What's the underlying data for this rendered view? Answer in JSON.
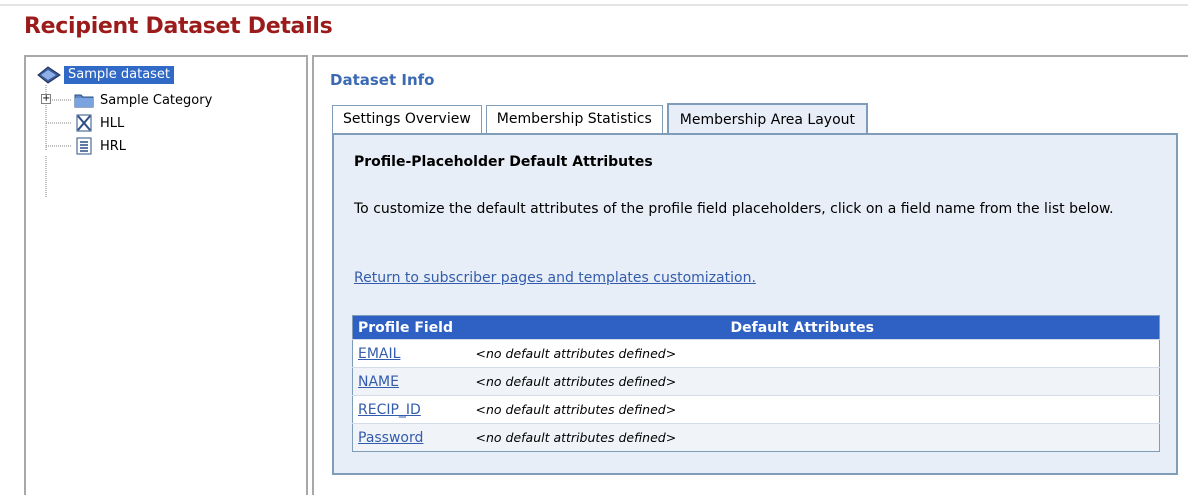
{
  "page": {
    "title": "Recipient Dataset Details"
  },
  "tree": {
    "root": {
      "label": "Sample dataset",
      "icon": "dataset-icon"
    },
    "items": [
      {
        "label": "Sample Category",
        "icon": "folder-icon",
        "expander": "+"
      },
      {
        "label": "HLL",
        "icon": "list-crossed-icon"
      },
      {
        "label": "HRL",
        "icon": "list-document-icon"
      }
    ]
  },
  "main": {
    "section_title": "Dataset Info",
    "tabs": [
      {
        "label": "Settings Overview",
        "active": false
      },
      {
        "label": "Membership Statistics",
        "active": false
      },
      {
        "label": "Membership Area Layout",
        "active": true
      }
    ],
    "heading": "Profile-Placeholder Default Attributes",
    "description": "To customize the default attributes of the profile field placeholders, click on a field name from the list below.",
    "return_link": "Return to subscriber pages and templates customization.",
    "table": {
      "columns": [
        "Profile Field",
        "Default Attributes"
      ],
      "rows": [
        {
          "field": "EMAIL",
          "attributes": "<no default attributes defined>"
        },
        {
          "field": "NAME",
          "attributes": "<no default attributes defined>"
        },
        {
          "field": "RECIP_ID",
          "attributes": "<no default attributes defined>"
        },
        {
          "field": "Password",
          "attributes": "<no default attributes defined>"
        }
      ]
    }
  },
  "colors": {
    "title": "#9b1b1b",
    "section_title": "#3c6ab2",
    "header_bg": "#2f60c4",
    "link": "#335cad",
    "selection": "#3169c6"
  }
}
